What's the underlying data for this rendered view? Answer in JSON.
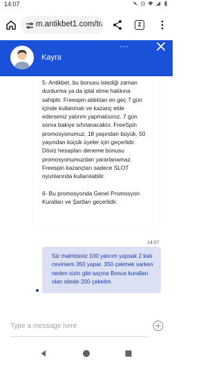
{
  "status_bar": {
    "time": "14:07",
    "icons": [
      "mute-icon",
      "alarm-icon",
      "wifi-icon",
      "signal-icon",
      "battery-icon"
    ]
  },
  "browser": {
    "url": "m.antikbet1.com/tr/",
    "tab_count": "2",
    "icons": [
      "home-icon",
      "tune-icon",
      "share-icon",
      "tab-switcher-icon",
      "overflow-menu-icon"
    ]
  },
  "chat_header": {
    "agent_name": "Kayra",
    "menu_label": "...",
    "accent_color": "#1a51d9"
  },
  "messages": {
    "agent": {
      "lines": [
        "5- Antikbet, bu bonusu istediği zaman",
        "durdurma ya da iptal etme hakkına",
        "sahiptir. Freespin aldıktan en geç 7 gün",
        "içinde kullanmalı ve kazanç elde",
        "ederseniz yatırım yapmalısınız. 7 gün",
        "sonra bakiye sıfırlanacaktır. FreeSpin",
        "promosyonumuz, 18 yaşından büyük, 50",
        "yaşından küçük üyeler için geçerlidir.",
        "Döviz hesapları deneme bonusu",
        "promosyonumuzdan yararlanamaz.",
        "Freespin kazançları sadece SLOT",
        "oyunlarında kullanılabilir."
      ],
      "rule6": "6- Bu promosyonda Genel Promosyon Kuralları ve Şartları geçerlidir."
    },
    "timestamp": "14:07",
    "user": {
      "text": "Siz malmisiniz 100 yatırım yapsak 2 katı cevirsem 350 yapar. 350 çekmek varken neden sizin gibi saçma Bonus kuralları olan sitede 200 çekelim."
    }
  },
  "composer": {
    "placeholder": "Type a message here"
  },
  "nav": {
    "icons": [
      "back-icon",
      "home-circle-icon",
      "recents-icon"
    ]
  }
}
